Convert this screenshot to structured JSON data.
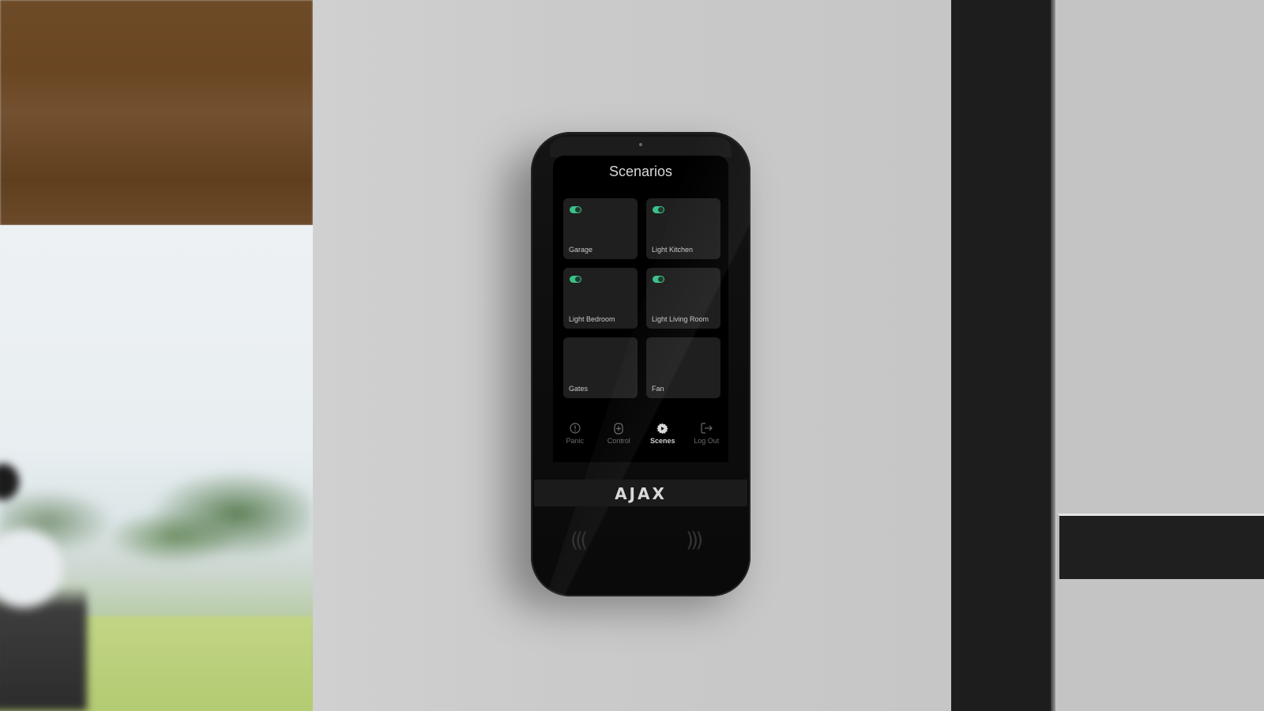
{
  "screen": {
    "title": "Scenarios",
    "scenes": [
      {
        "label": "Garage",
        "toggle": true,
        "toggle_on": true
      },
      {
        "label": "Light Kitchen",
        "toggle": true,
        "toggle_on": true
      },
      {
        "label": "Light Bedroom",
        "toggle": true,
        "toggle_on": true
      },
      {
        "label": "Light Living Room",
        "toggle": true,
        "toggle_on": true
      },
      {
        "label": "Gates",
        "toggle": false
      },
      {
        "label": "Fan",
        "toggle": false
      }
    ],
    "tabs": [
      {
        "label": "Panic",
        "icon": "alert-circle-icon",
        "active": false
      },
      {
        "label": "Control",
        "icon": "control-icon",
        "active": false
      },
      {
        "label": "Scenes",
        "icon": "scenes-gear-icon",
        "active": true
      },
      {
        "label": "Log Out",
        "icon": "logout-icon",
        "active": false
      }
    ]
  },
  "device": {
    "brand": "AJAX"
  },
  "colors": {
    "toggle_on": "#3cc08a",
    "tile": "#1f1f1f",
    "screen": "#000000"
  }
}
